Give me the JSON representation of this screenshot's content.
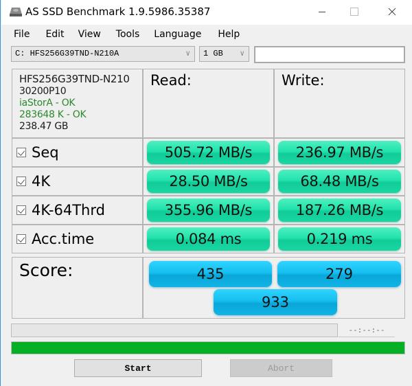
{
  "window": {
    "title": "AS SSD Benchmark 1.9.5986.35387",
    "icon": "drive-icon",
    "controls": {
      "minimize": "—",
      "maximize": "☐",
      "close": "✕"
    }
  },
  "menu": [
    {
      "label": "File"
    },
    {
      "label": "Edit"
    },
    {
      "label": "View"
    },
    {
      "label": "Tools"
    },
    {
      "label": "Language"
    },
    {
      "label": "Help"
    }
  ],
  "toolbar": {
    "drive_select": "C: HFS256G39TND-N210A",
    "size_select": "1 GB",
    "text_value": ""
  },
  "drive_info": {
    "model": "HFS256G39TND-N210",
    "firmware": "30200P10",
    "driver": "iaStorA - OK",
    "alignment": "283648 K - OK",
    "capacity": "238.47 GB"
  },
  "headers": {
    "read": "Read:",
    "write": "Write:"
  },
  "results": [
    {
      "label": "Seq",
      "checked": true,
      "read": "505.72 MB/s",
      "write": "236.97 MB/s"
    },
    {
      "label": "4K",
      "checked": true,
      "read": "28.50 MB/s",
      "write": "68.48 MB/s"
    },
    {
      "label": "4K-64Thrd",
      "checked": true,
      "read": "355.96 MB/s",
      "write": "187.26 MB/s"
    },
    {
      "label": "Acc.time",
      "checked": true,
      "read": "0.084 ms",
      "write": "0.219 ms"
    }
  ],
  "score": {
    "label": "Score:",
    "read": "435",
    "write": "279",
    "total": "933"
  },
  "progress": {
    "timer": "--:--:--",
    "step_progress": 0,
    "overall_progress": 1.0
  },
  "buttons": {
    "start": "Start",
    "abort": "Abort"
  },
  "colors": {
    "result_bar": "#22e3ad",
    "score_bar": "#15bff0",
    "progress_fill": "#06b025",
    "status_ok": "#2c8a2c"
  }
}
